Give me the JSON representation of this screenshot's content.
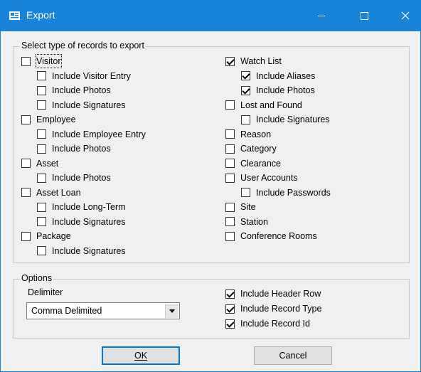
{
  "window": {
    "title": "Export"
  },
  "records_group": {
    "legend": "Select type of records to export",
    "left": [
      {
        "label": "Visitor",
        "checked": false,
        "level": 0
      },
      {
        "label": "Include Visitor Entry",
        "checked": false,
        "level": 1
      },
      {
        "label": "Include Photos",
        "checked": false,
        "level": 1
      },
      {
        "label": "Include Signatures",
        "checked": false,
        "level": 1
      },
      {
        "label": "Employee",
        "checked": false,
        "level": 0
      },
      {
        "label": "Include Employee Entry",
        "checked": false,
        "level": 1
      },
      {
        "label": "Include Photos",
        "checked": false,
        "level": 1
      },
      {
        "label": "Asset",
        "checked": false,
        "level": 0
      },
      {
        "label": "Include Photos",
        "checked": false,
        "level": 1
      },
      {
        "label": "Asset Loan",
        "checked": false,
        "level": 0
      },
      {
        "label": "Include Long-Term",
        "checked": false,
        "level": 1
      },
      {
        "label": "Include Signatures",
        "checked": false,
        "level": 1
      },
      {
        "label": "Package",
        "checked": false,
        "level": 0
      },
      {
        "label": "Include Signatures",
        "checked": false,
        "level": 1
      }
    ],
    "right": [
      {
        "label": "Watch List",
        "checked": true,
        "level": 0
      },
      {
        "label": "Include Aliases",
        "checked": true,
        "level": 1
      },
      {
        "label": "Include Photos",
        "checked": true,
        "level": 1
      },
      {
        "label": "Lost and Found",
        "checked": false,
        "level": 0
      },
      {
        "label": "Include Signatures",
        "checked": false,
        "level": 1
      },
      {
        "label": "Reason",
        "checked": false,
        "level": 0
      },
      {
        "label": "Category",
        "checked": false,
        "level": 0
      },
      {
        "label": "Clearance",
        "checked": false,
        "level": 0
      },
      {
        "label": "User Accounts",
        "checked": false,
        "level": 0
      },
      {
        "label": "Include Passwords",
        "checked": false,
        "level": 1
      },
      {
        "label": "Site",
        "checked": false,
        "level": 0
      },
      {
        "label": "Station",
        "checked": false,
        "level": 0
      },
      {
        "label": "Conference Rooms",
        "checked": false,
        "level": 0
      }
    ]
  },
  "options_group": {
    "legend": "Options",
    "delimiter_label": "Delimiter",
    "delimiter_value": "Comma Delimited",
    "checks": [
      {
        "label": "Include Header Row",
        "checked": true
      },
      {
        "label": "Include Record Type",
        "checked": true
      },
      {
        "label": "Include Record Id",
        "checked": true
      }
    ]
  },
  "buttons": {
    "ok": "OK",
    "cancel": "Cancel"
  },
  "colors": {
    "titlebar": "#1883d7",
    "accent": "#0078d7"
  }
}
